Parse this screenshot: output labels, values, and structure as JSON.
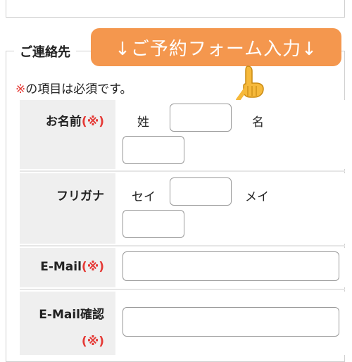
{
  "banner": {
    "text": "↓ご予約フォーム入力↓"
  },
  "section": {
    "legend": "ご連絡先"
  },
  "note": {
    "mark": "※",
    "text": "の項目は必須です。"
  },
  "rows": {
    "name": {
      "label": "お名前",
      "required": "(※)",
      "sei_label": "姓",
      "mei_label": "名",
      "sei_value": "",
      "mei_value": ""
    },
    "kana": {
      "label": "フリガナ",
      "sei_label": "セイ",
      "mei_label": "メイ",
      "sei_value": "",
      "mei_value": ""
    },
    "email": {
      "label": "E-Mail",
      "required": "(※)",
      "value": ""
    },
    "email_confirm": {
      "label": "E-Mail確認",
      "required": "(※)",
      "value": ""
    }
  },
  "colors": {
    "banner": "#f4974e",
    "required": "#e53935",
    "label_bg": "#efefef"
  },
  "icons": {
    "pointer": "pointing-hand-icon"
  }
}
